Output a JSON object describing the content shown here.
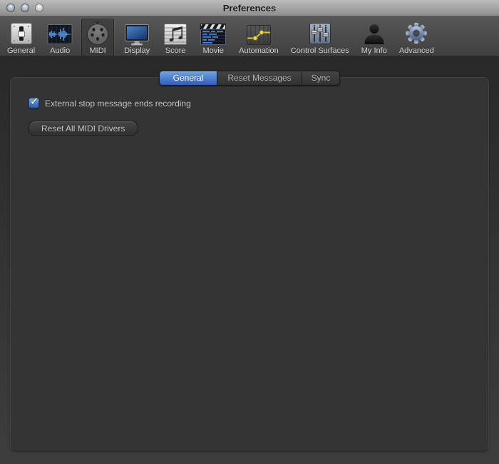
{
  "window": {
    "title": "Preferences"
  },
  "toolbar": {
    "items": [
      {
        "label": "General",
        "icon": "general-icon",
        "selected": false
      },
      {
        "label": "Audio",
        "icon": "audio-icon",
        "selected": false
      },
      {
        "label": "MIDI",
        "icon": "midi-icon",
        "selected": true
      },
      {
        "label": "Display",
        "icon": "display-icon",
        "selected": false
      },
      {
        "label": "Score",
        "icon": "score-icon",
        "selected": false
      },
      {
        "label": "Movie",
        "icon": "movie-icon",
        "selected": false
      },
      {
        "label": "Automation",
        "icon": "automation-icon",
        "selected": false
      },
      {
        "label": "Control Surfaces",
        "icon": "control-surfaces-icon",
        "selected": false
      },
      {
        "label": "My Info",
        "icon": "my-info-icon",
        "selected": false
      },
      {
        "label": "Advanced",
        "icon": "advanced-icon",
        "selected": false
      }
    ]
  },
  "tabs": [
    {
      "label": "General",
      "selected": true
    },
    {
      "label": "Reset Messages",
      "selected": false
    },
    {
      "label": "Sync",
      "selected": false
    }
  ],
  "checkbox": {
    "label": "External stop message ends recording",
    "checked": true,
    "mark": "✓"
  },
  "button": {
    "label": "Reset All MIDI Drivers"
  },
  "colors": {
    "selected_tab_blue_top": "#6ea4e6",
    "selected_tab_blue_bottom": "#2d5fb6",
    "checkbox_blue_top": "#74a5e3",
    "checkbox_blue_bottom": "#2b5bab",
    "panel_background": "#343434",
    "toolbar_top": "#585858",
    "titlebar_top": "#bcbcbc"
  }
}
